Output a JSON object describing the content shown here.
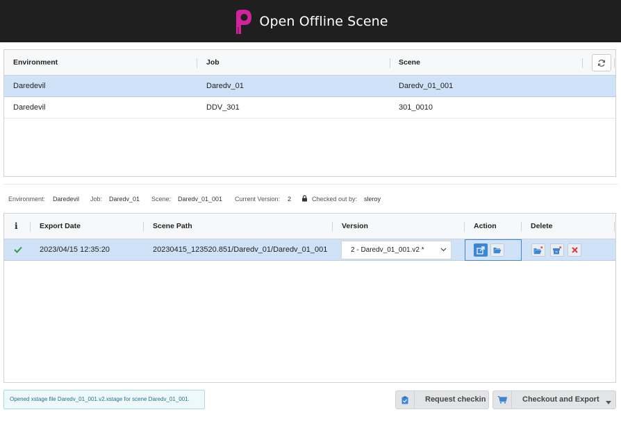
{
  "window": {
    "title": "Open Offline Scene"
  },
  "scenes_table": {
    "columns": [
      "Environment",
      "Job",
      "Scene"
    ],
    "rows": [
      {
        "environment": "Daredevil",
        "job": "Daredv_01",
        "scene": "Daredv_01_001",
        "selected": true
      },
      {
        "environment": "Daredevil",
        "job": "DDV_301",
        "scene": "301_0010",
        "selected": false
      }
    ],
    "refresh_icon": "refresh-icon"
  },
  "info_bar": {
    "environment_label": "Environment:",
    "environment_value": "Daredevil",
    "job_label": "Job:",
    "job_value": "Daredv_01",
    "scene_label": "Scene:",
    "scene_value": "Daredv_01_001",
    "version_label": "Current Version:",
    "version_value": "2",
    "checked_out_label": "Checked out by:",
    "checked_out_value": "sleroy",
    "lock_icon": "lock-icon"
  },
  "versions_table": {
    "columns": [
      "i",
      "Export Date",
      "Scene Path",
      "Version",
      "Action",
      "Delete"
    ],
    "rows": [
      {
        "status_icon": "check-icon",
        "export_date": "2023/04/15 12:35:20",
        "scene_path": "20230415_123520.851/Daredv_01/Daredv_01_001",
        "version": "2 - Daredv_01_001.v2 *"
      }
    ]
  },
  "status_message": "Opened xstage file Daredv_01_001.v2.xstage for scene Daredv_01_001.",
  "buttons": {
    "request_checkin": "Request checkin",
    "checkout_export": "Checkout and Export"
  },
  "colors": {
    "titlebar": "#1f1f1f",
    "accent": "#3d86d3",
    "selected_row": "#cfe2f7",
    "logo": "#d1239a",
    "success": "#2e9b3e",
    "danger": "#d9363e"
  }
}
